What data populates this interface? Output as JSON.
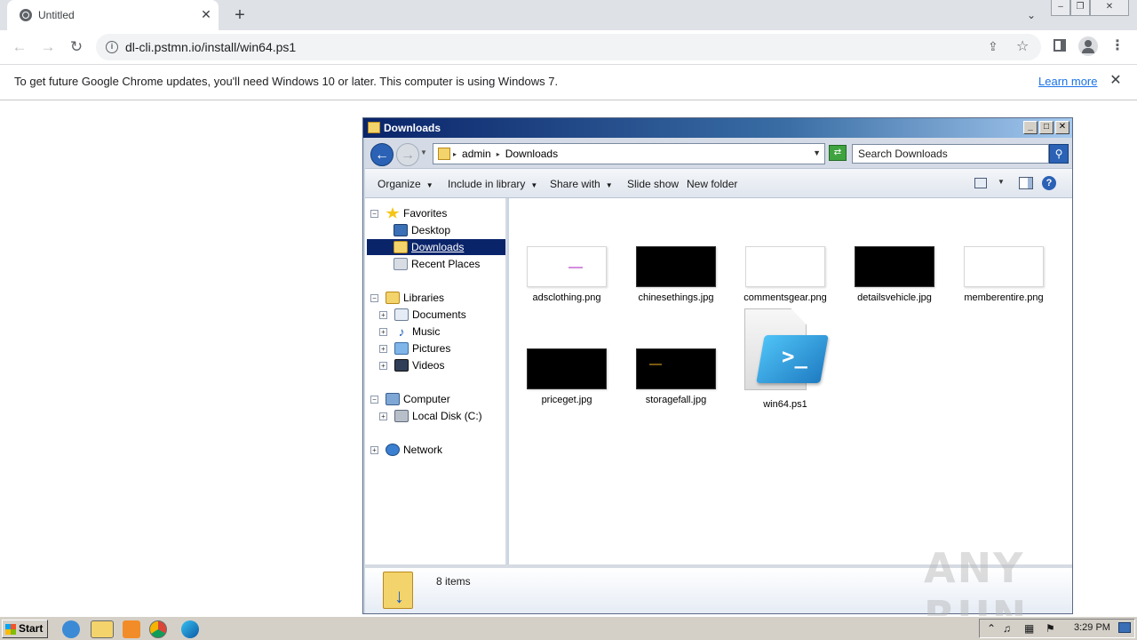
{
  "browser": {
    "tab_title": "Untitled",
    "url": "dl-cli.pstmn.io/install/win64.ps1"
  },
  "infobar": {
    "message": "To get future Google Chrome updates, you'll need Windows 10 or later. This computer is using Windows 7.",
    "learn_more": "Learn more"
  },
  "explorer": {
    "title": "Downloads",
    "breadcrumb": [
      "admin",
      "Downloads"
    ],
    "search_placeholder": "Search Downloads",
    "commands": [
      "Organize",
      "Include in library",
      "Share with",
      "Slide show",
      "New folder"
    ],
    "nav": {
      "favorites": "Favorites",
      "desktop": "Desktop",
      "downloads": "Downloads",
      "recent": "Recent Places",
      "libraries": "Libraries",
      "documents": "Documents",
      "music": "Music",
      "pictures": "Pictures",
      "videos": "Videos",
      "computer": "Computer",
      "local_disk": "Local Disk (C:)",
      "network": "Network"
    },
    "files": [
      {
        "name": "adsclothing.png",
        "thumb": "white"
      },
      {
        "name": "chinesethings.jpg",
        "thumb": "black"
      },
      {
        "name": "commentsgear.png",
        "thumb": "white"
      },
      {
        "name": "detailsvehicle.jpg",
        "thumb": "black"
      },
      {
        "name": "memberentire.png",
        "thumb": "white"
      },
      {
        "name": "priceget.jpg",
        "thumb": "black"
      },
      {
        "name": "storagefall.jpg",
        "thumb": "black"
      },
      {
        "name": "win64.ps1",
        "thumb": "powershell-script"
      }
    ],
    "item_count": "8 items"
  },
  "taskbar": {
    "start_label": "Start",
    "clock": "3:29 PM"
  },
  "watermark": "ANY RUN",
  "colors": {
    "explorer_title_bar": "#0a246a",
    "selection": "#0a246a",
    "link": "#1a73e8",
    "taskbar": "#d4d0c8"
  }
}
